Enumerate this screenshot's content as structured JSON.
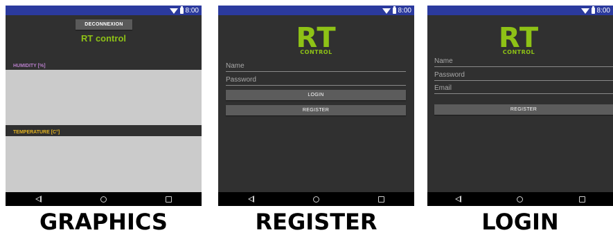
{
  "status_bar": {
    "time": "8:00"
  },
  "graphics_screen": {
    "logout_button": "DECONNEXION",
    "title": "RT control",
    "humidity_label": "HUMIDITY [%]",
    "temperature_label": "TEMPERATURE [C°]"
  },
  "register_screen": {
    "logo_main": "RT",
    "logo_sub": "CONTROL",
    "name_hint": "Name",
    "password_hint": "Password",
    "login_button": "LOGIN",
    "register_button": "REGISTER"
  },
  "login_screen": {
    "logo_main": "RT",
    "logo_sub": "CONTROL",
    "name_hint": "Name",
    "password_hint": "Password",
    "email_hint": "Email",
    "register_button": "REGISTER"
  },
  "captions": {
    "graphics": "GRAPHICS",
    "register": "REGISTER",
    "login": "LOGIN"
  },
  "colors": {
    "accent_green": "#8ec216",
    "status_bar_blue": "#2b3a9e",
    "humidity_purple": "#b77ec9",
    "temperature_yellow": "#e3b321",
    "background_dark": "#303030",
    "chart_gray": "#cbcbcb"
  },
  "icons": [
    "wifi-icon",
    "battery-icon",
    "nav-back-icon",
    "nav-home-icon",
    "nav-recent-icon"
  ]
}
